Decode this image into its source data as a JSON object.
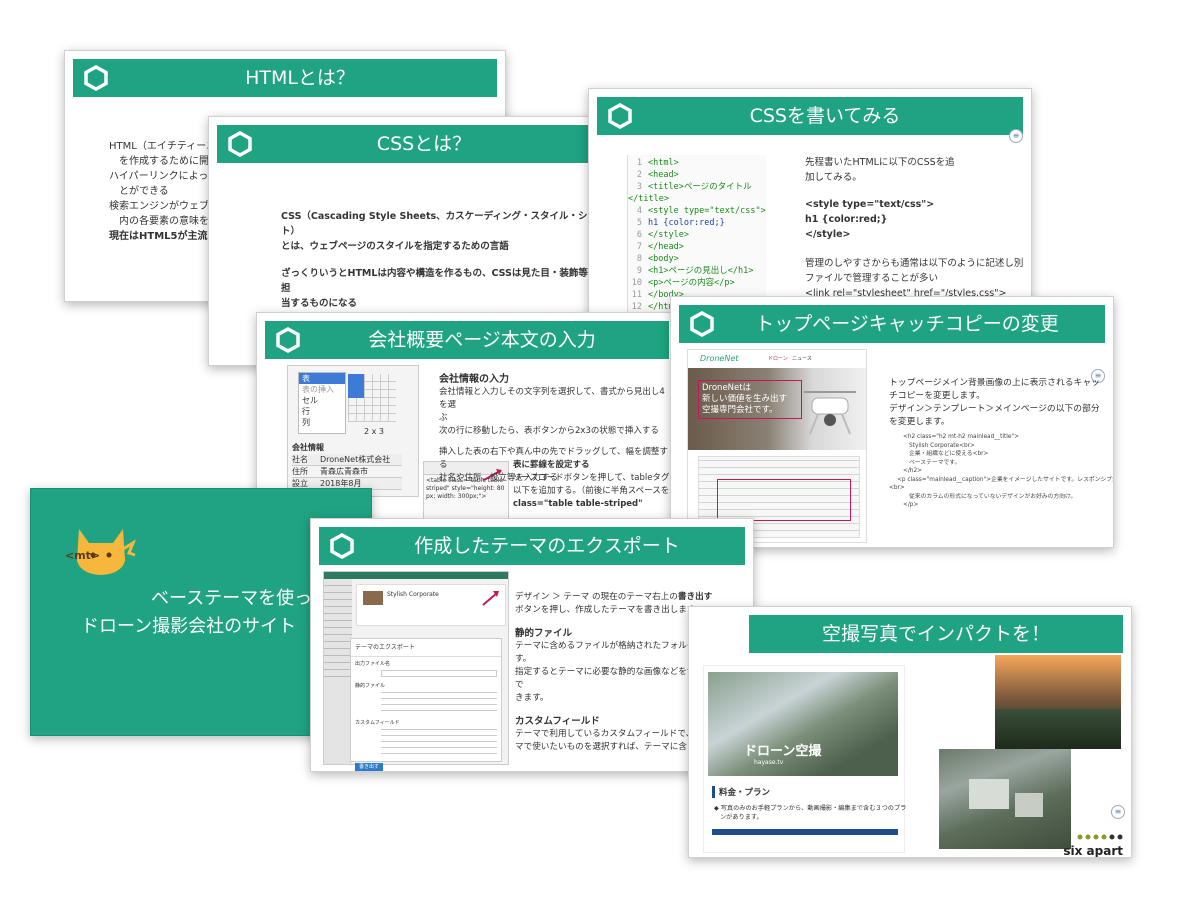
{
  "slide_html": {
    "title": "HTMLとは？",
    "bullets": [
      "HTML（エイチティーエ",
      "を作成するために開発さ",
      "ハイパーリンクによって",
      "とができる",
      "検索エンジンがウェブペ",
      "内の各要素の意味を理解",
      "現在はHTML5が主流"
    ]
  },
  "slide_css": {
    "title": "CSSとは？",
    "p1a": "CSS（Cascading Style Sheets、カスケーディング・スタイル・シート）",
    "p1b": "とは、ウェブページのスタイルを指定するための言語",
    "p2a": "ざっくりいうとHTMLは内容や構造を作るもの、CSSは見た目・装飾等を担",
    "p2b": "当するものになる"
  },
  "slide_write_css": {
    "title": "CSSを書いてみる",
    "code_lines": [
      {
        "n": "1",
        "t": "<html>"
      },
      {
        "n": "2",
        "t": "<head>"
      },
      {
        "n": "3",
        "t": "<title>ページのタイトル</title>"
      },
      {
        "n": "4",
        "t": "<style type=\"text/css\">"
      },
      {
        "n": "5",
        "t": "h1 {color:red;}"
      },
      {
        "n": "6",
        "t": "</style>"
      },
      {
        "n": "7",
        "t": "</head>"
      },
      {
        "n": "8",
        "t": "<body>"
      },
      {
        "n": "9",
        "t": "<h1>ページの見出し</h1>"
      },
      {
        "n": "10",
        "t": "<p>ページの内容</p>"
      },
      {
        "n": "11",
        "t": "</body>"
      },
      {
        "n": "12",
        "t": "</html>"
      }
    ],
    "desc1a": "先程書いたHTMLに以下のCSSを追",
    "desc1b": "加してみる。",
    "snippet1": "<style type=\"text/css\">",
    "snippet2": "h1 {color:red;}",
    "snippet3": "</style>",
    "desc2a": "管理のしやすさからも通常は以下のように記述し別",
    "desc2b": "ファイルで管理することが多い",
    "desc2c": "<link rel=\"stylesheet\" href=\"/styles.css\">"
  },
  "slide_company": {
    "title": "会社概要ページ本文の入力",
    "h1": "会社情報の入力",
    "t1a": "会社情報と入力しその文字列を選択して、書式から見出し4を選",
    "t1b": "ぶ",
    "t1c": "次の行に移動したら、表ボタンから2x3の状態で挿入する",
    "t2a": "挿入した表の右下や真ん中の先でドラッグして、幅を調整する",
    "t2b": "社名や住所、設立等を入力する",
    "h2": "表に罫線を設定する",
    "t3a": "ソースコードボタンを押して、tableタグのところに",
    "t3b": "以下を追加する。（前後に半角スペースを入れる）",
    "t3c": "class=\"table table-striped\"",
    "ss_heading": "会社情報",
    "ss_rows": [
      {
        "k": "社名",
        "v": "DroneNet株式会社"
      },
      {
        "k": "住所",
        "v": "青森広青森市"
      },
      {
        "k": "設立",
        "v": "2018年8月"
      }
    ],
    "ss_menu": [
      "表",
      "表の挿入",
      "セル",
      "行",
      "列"
    ],
    "ss_grid_label": "2 x 3",
    "ss_code": "<table class=\"table table-striped\" style=\"height: 80px; width: 300px;\">"
  },
  "slide_catch": {
    "title": "トップページキャッチコピーの変更",
    "brand": "DroneNet",
    "nav1": "ドローン",
    "nav2": "ニュース",
    "hero1": "DroneNetは",
    "hero2": "新しい価値を生み出す",
    "hero3": "空撮専門会社です。",
    "p1a": "トップページメイン背景画像の上に表示されるキャッ",
    "p1b": "チコピーを変更します。",
    "p1c": "デザイン＞テンプレート＞メインページの以下の部分",
    "p1d": "を変更します。",
    "c1": "<h2 class=\"h2 mt-h2 mainlead__title\">",
    "c2": "Stylish Corporate<br>",
    "c3": "企業・組織などに使える<br>",
    "c4": "ベーステーマです。",
    "c5": "</h2>",
    "c6": "<p class=\"mainlead__caption\">企業をイメージしたサイトです。レスポンシブ対応済み。",
    "c7": "<br>",
    "c8": "従来のカラムの形式になっていないデザインがお好みの方向け。",
    "c9": "</p>"
  },
  "slide_base": {
    "line1": "ベーステーマを使って",
    "line2": "ドローン撮影会社のサイト",
    "mascot_text": "<mt>"
  },
  "slide_export": {
    "title": "作成したテーマのエクスポート",
    "p1a": "デザイン ＞ テーマ の現在のテーマ右上の",
    "p1b": "書き出す",
    "p1c": "ボタンを押し、作成したテーマを書き出します。",
    "h2": "静的ファイル",
    "p2a": "テーマに含めるファイルが格納されたフォルダを指定します。",
    "p2b": "指定するとテーマに必要な静的な画像などを含めることがで",
    "p2c": "きます。",
    "h3": "カスタムフィールド",
    "p3a": "テーマで利用しているカスタムフィールドで、書き出すテー",
    "p3b": "マで使いたいものを選択すれば、テーマに含まれます。",
    "ss_panel_title": "テーマのエクスポート",
    "ss_theme_label": "Stylish Corporate",
    "ss_field1": "出力ファイル名",
    "ss_field2": "静的ファイル",
    "ss_field3": "カスタムフィールド",
    "ss_button": "書き出す"
  },
  "slide_aerial": {
    "title": "空撮写真でインパクトを！",
    "overlay": "ドローン空撮",
    "overlay_sub": "hayase.tv",
    "section": "料金・プラン",
    "note1": "◆ 写真のみのお手軽プランから、動画撮影・編集まで含む３つのプラ",
    "note2": "ンがあります。",
    "brand": "six apart"
  },
  "colors": {
    "accent": "#1fa382",
    "highlight": "#c2185b"
  }
}
